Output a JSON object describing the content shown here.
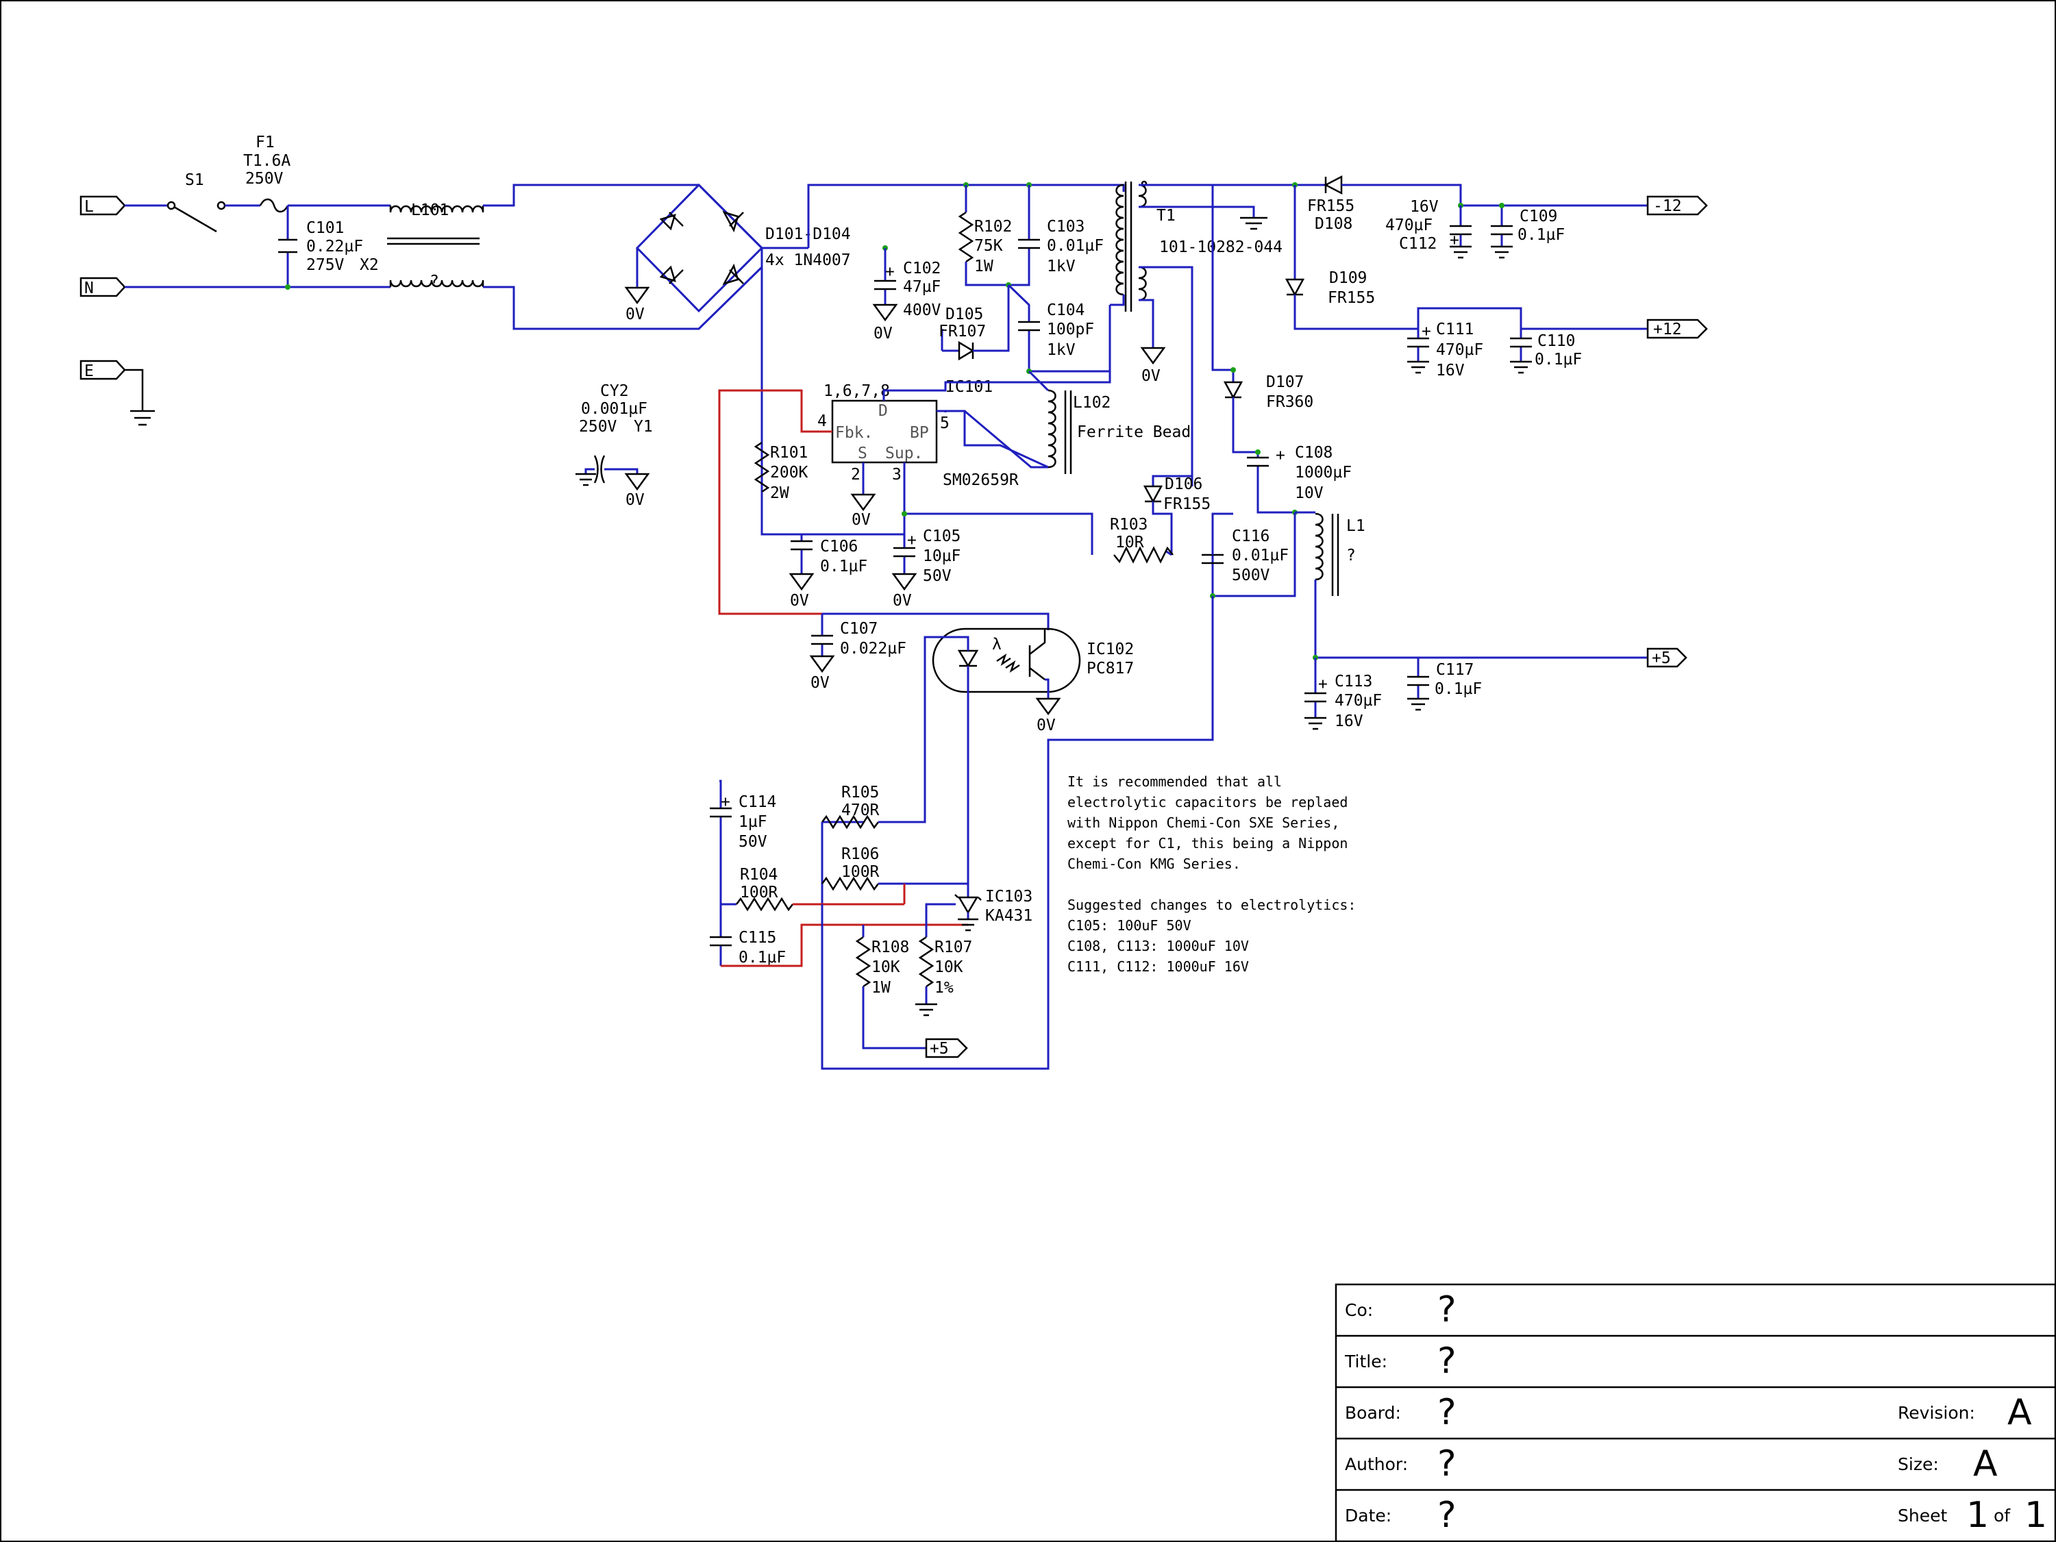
{
  "ports": {
    "L": "L",
    "N": "N",
    "E": "E",
    "m12": "-12",
    "p12": "+12",
    "p5": "+5",
    "p5b": "+5"
  },
  "components": {
    "f1": [
      "F1",
      "T1.6A",
      "250V"
    ],
    "s1": "S1",
    "c101": [
      "C101",
      "0.22µF",
      "275V",
      "X2"
    ],
    "l101": [
      "L101",
      "?"
    ],
    "bridge": [
      "D101-D104",
      "4x 1N4007"
    ],
    "c102": [
      "C102",
      "47µF",
      "400V"
    ],
    "r102": [
      "R102",
      "75K",
      "1W"
    ],
    "c103": [
      "C103",
      "0.01µF",
      "1kV"
    ],
    "c104": [
      "C104",
      "100pF",
      "1kV"
    ],
    "d105": [
      "D105",
      "FR107"
    ],
    "t1": [
      "T1",
      "101-10282-044"
    ],
    "d108": [
      "FR155",
      "D108"
    ],
    "c112": [
      "16V",
      "470µF",
      "C112"
    ],
    "c109": [
      "C109",
      "0.1µF"
    ],
    "d109": [
      "D109",
      "FR155"
    ],
    "c111": [
      "C111",
      "470µF",
      "16V"
    ],
    "c110": [
      "C110",
      "0.1µF"
    ],
    "d107": [
      "D107",
      "FR360"
    ],
    "c108": [
      "C108",
      "1000µF",
      "10V"
    ],
    "l1": [
      "L1",
      "?"
    ],
    "c116": [
      "C116",
      "0.01µF",
      "500V"
    ],
    "d106": [
      "D106",
      "FR155"
    ],
    "r103": [
      "R103",
      "10R"
    ],
    "l102": [
      "L102",
      "Ferrite Bead"
    ],
    "ic101": {
      "name": "IC101",
      "part": "SM02659R",
      "pins_top": "1,6,7,8",
      "pin_d": "D",
      "pin_fbk": "Fbk.",
      "pin_bp": "BP",
      "pin_s": "S",
      "pin_sup": "Sup.",
      "n4": "4",
      "n5": "5",
      "n2": "2",
      "n3": "3"
    },
    "cy2": [
      "CY2",
      "0.001µF",
      "250V",
      "Y1"
    ],
    "r101": [
      "R101",
      "200K",
      "2W"
    ],
    "c106": [
      "C106",
      "0.1µF"
    ],
    "c105": [
      "C105",
      "10µF",
      "50V"
    ],
    "c107": [
      "C107",
      "0.022µF"
    ],
    "ic102": [
      "IC102",
      "PC817"
    ],
    "c113": [
      "C113",
      "470µF",
      "16V"
    ],
    "c117": [
      "C117",
      "0.1µF"
    ],
    "c114": [
      "C114",
      "1µF",
      "50V"
    ],
    "r105": [
      "R105",
      "470R"
    ],
    "r106": [
      "R106",
      "100R"
    ],
    "r104": [
      "R104",
      "100R"
    ],
    "c115": [
      "C115",
      "0.1µF"
    ],
    "ic103": [
      "IC103",
      "KA431"
    ],
    "r108": [
      "R108",
      "10K",
      "1W"
    ],
    "r107": [
      "R107",
      "10K",
      "1%"
    ]
  },
  "ground_label": "0V",
  "lambda": "λ",
  "plus": "+",
  "note_lines": [
    "It is recommended that all",
    "electrolytic capacitors be replaed",
    "with Nippon Chemi-Con SXE Series,",
    "except for C1, this being a Nippon",
    "Chemi-Con KMG Series.",
    "",
    "Suggested changes to electrolytics:",
    "C105: 100uF 50V",
    "C108, C113: 1000uF 10V",
    "C111, C112: 1000uF 16V"
  ],
  "title_block": {
    "co_label": "Co:",
    "co": "?",
    "title_label": "Title:",
    "title": "?",
    "board_label": "Board:",
    "board": "?",
    "revision_label": "Revision:",
    "revision": "A",
    "author_label": "Author:",
    "author": "?",
    "size_label": "Size:",
    "size": "A",
    "date_label": "Date:",
    "date": "?",
    "sheet_label": "Sheet",
    "sheet": "1",
    "of_label": "of",
    "sheets": "1"
  }
}
